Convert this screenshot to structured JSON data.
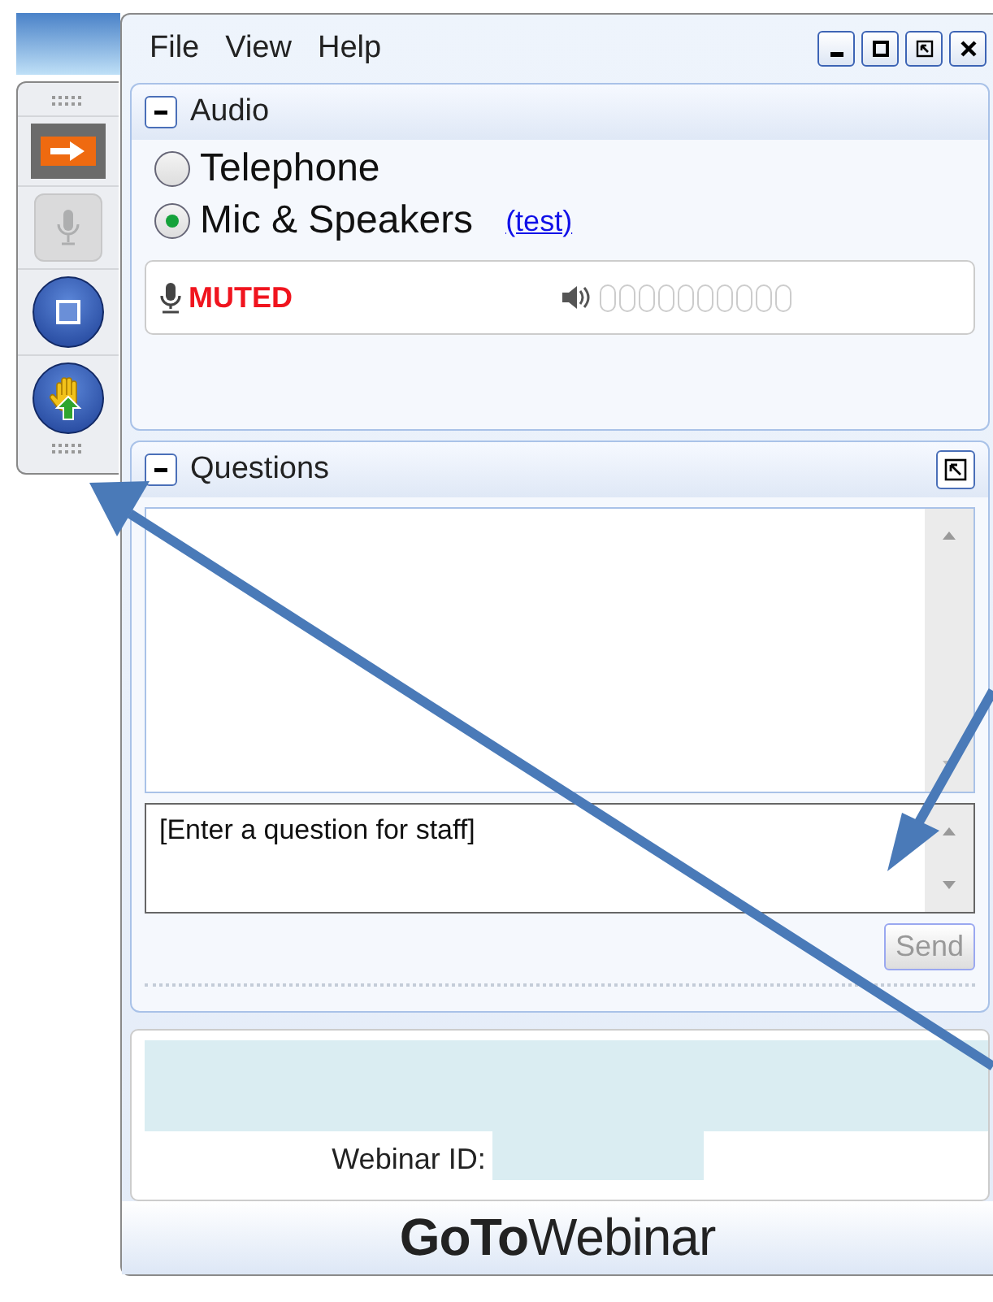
{
  "menu": [
    {
      "label": "File"
    },
    {
      "label": "View"
    },
    {
      "label": "Help"
    }
  ],
  "toolbar": [
    {
      "kind": "arrow",
      "disabled": false
    },
    {
      "kind": "mic",
      "disabled": true
    },
    {
      "kind": "screen",
      "disabled": false
    },
    {
      "kind": "hand",
      "disabled": false
    }
  ],
  "audio": {
    "title": "Audio",
    "expanded": true,
    "options": [
      {
        "label": "Telephone",
        "selected": false
      },
      {
        "label": "Mic & Speakers",
        "selected": true
      }
    ],
    "test_link": "(test)",
    "mic_status": "MUTED",
    "level": 0
  },
  "questions": {
    "title": "Questions",
    "expanded": true,
    "placeholder": "[Enter a question for staff]",
    "send": {
      "label": "Send",
      "disabled": true
    }
  },
  "info": {
    "webinar_id_label": "Webinar ID:"
  },
  "logo": "**GoTo**Webinar"
}
